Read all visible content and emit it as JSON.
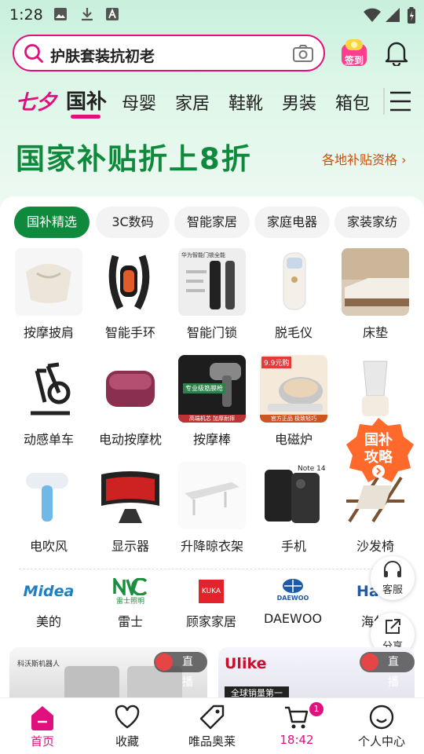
{
  "status_bar": {
    "time": "1:28"
  },
  "search": {
    "query": "护肤套装抗初老"
  },
  "header": {
    "signin_label": "签到"
  },
  "categories": {
    "festival": "七夕",
    "items": [
      "国补",
      "母婴",
      "家居",
      "鞋靴",
      "男装",
      "箱包"
    ],
    "active": "国补"
  },
  "banner": {
    "title": "国家补贴折上8折",
    "link": "各地补贴资格"
  },
  "chips": [
    "国补精选",
    "3C数码",
    "智能家居",
    "家庭电器",
    "家装家纺"
  ],
  "products": [
    {
      "label": "按摩披肩"
    },
    {
      "label": "智能手环"
    },
    {
      "label": "智能门锁"
    },
    {
      "label": "脱毛仪"
    },
    {
      "label": "床垫"
    },
    {
      "label": "动感单车"
    },
    {
      "label": "电动按摩枕"
    },
    {
      "label": "按摩棒"
    },
    {
      "label": "电磁炉"
    },
    {
      "label": ""
    },
    {
      "label": "电吹风"
    },
    {
      "label": "显示器"
    },
    {
      "label": "升降晾衣架"
    },
    {
      "label": "手机"
    },
    {
      "label": "沙发椅"
    }
  ],
  "product_img_text": {
    "lock": "华为智能门锁全能",
    "massager": "专业级筋膜枪",
    "massager_bottom": "高端机芯  加厚耐摔",
    "cooker_top": "9.9元购",
    "cooker_bottom": "官方正品  极致轻巧",
    "phone": "Note 14"
  },
  "promo_badge": {
    "line1": "国补",
    "line2": "攻略"
  },
  "brands": [
    {
      "name": "美的",
      "logo_text": "Midea"
    },
    {
      "name": "雷士",
      "logo_text": "雷士照明"
    },
    {
      "name": "顾家家居",
      "logo_text": "KUKA"
    },
    {
      "name": "DAEWOO",
      "logo_text": "DAEWOO"
    },
    {
      "name": "海尔",
      "logo_text": "Haier"
    }
  ],
  "floating": {
    "service": "客服",
    "share": "分享"
  },
  "live_cards": [
    {
      "tag": "直播",
      "brand": "科沃斯机器人"
    },
    {
      "tag": "直播",
      "brand": "Ulike",
      "subtitle": "全球销量第一"
    }
  ],
  "tabbar": {
    "tabs": [
      {
        "label": "首页"
      },
      {
        "label": "收藏"
      },
      {
        "label": "唯品奥莱"
      },
      {
        "label": "18:42"
      },
      {
        "label": "个人中心"
      }
    ],
    "cart_badge": "1"
  },
  "colors": {
    "brand": "#e0107f",
    "green": "#0f8a3c",
    "link": "#d44a00"
  }
}
